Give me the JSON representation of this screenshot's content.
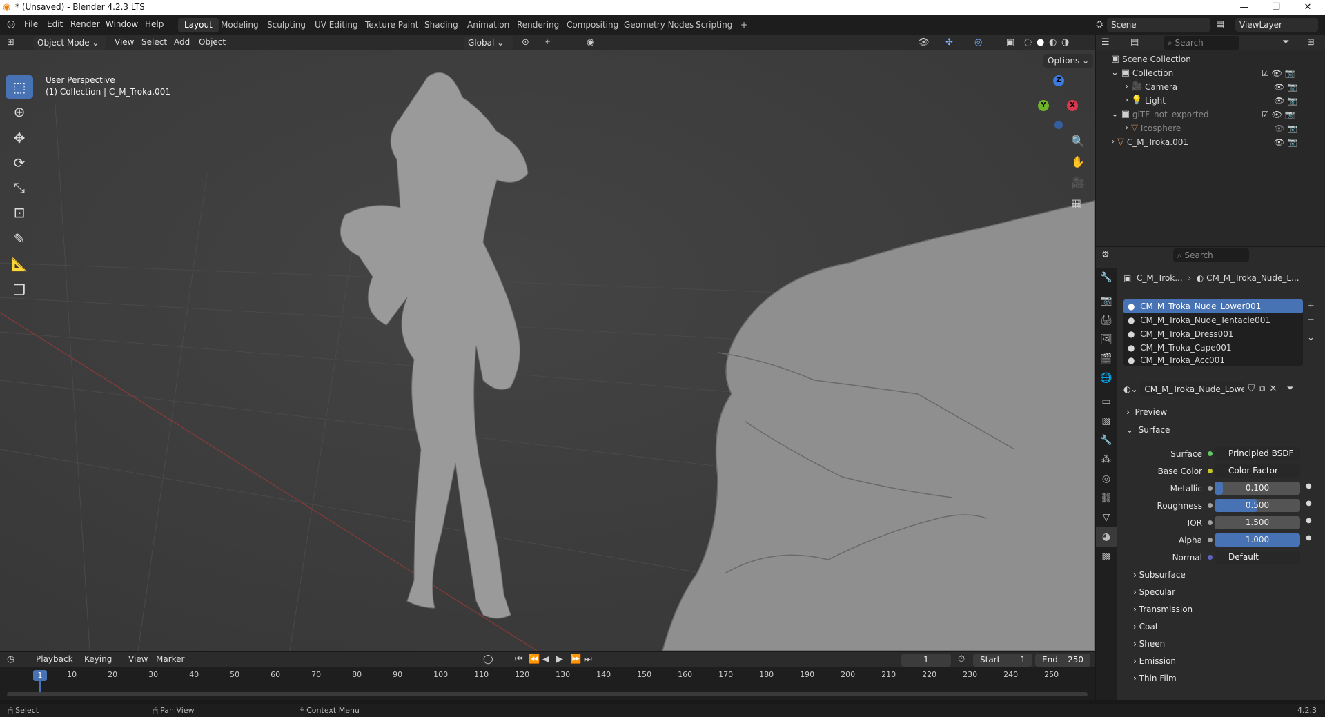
{
  "window": {
    "title": "* (Unsaved) - Blender 4.2.3 LTS",
    "min": "—",
    "max": "❐",
    "close": "✕"
  },
  "menu": [
    "File",
    "Edit",
    "Render",
    "Window",
    "Help"
  ],
  "workspaces": [
    "Layout",
    "Modeling",
    "Sculpting",
    "UV Editing",
    "Texture Paint",
    "Shading",
    "Animation",
    "Rendering",
    "Compositing",
    "Geometry Nodes",
    "Scripting"
  ],
  "add_ws": "+",
  "scene": {
    "name": "Scene",
    "viewlayer": "ViewLayer"
  },
  "viewport": {
    "mode": "Object Mode",
    "menus": [
      "View",
      "Select",
      "Add",
      "Object"
    ],
    "orientation": "Global",
    "options": "Options",
    "overlay_line1": "User Perspective",
    "overlay_line2": "(1) Collection | C_M_Troka.001",
    "gizmo": {
      "z": "Z",
      "y": "Y",
      "x": "X"
    }
  },
  "outliner": {
    "search_placeholder": "Search",
    "rows": [
      {
        "label": "Scene Collection"
      },
      {
        "label": "Collection"
      },
      {
        "label": "Camera"
      },
      {
        "label": "Light"
      },
      {
        "label": "glTF_not_exported"
      },
      {
        "label": "Icosphere"
      },
      {
        "label": "C_M_Troka.001"
      }
    ]
  },
  "properties": {
    "search_placeholder": "Search",
    "breadcrumb_obj": "C_M_Trok...",
    "breadcrumb_mat": "CM_M_Troka_Nude_L...",
    "slots": [
      "CM_M_Troka_Nude_Lower001",
      "CM_M_Troka_Nude_Tentacle001",
      "CM_M_Troka_Dress001",
      "CM_M_Troka_Cape001",
      "CM_M_Troka_Acc001"
    ],
    "material_name": "CM_M_Troka_Nude_Lowe...",
    "preview": "Preview",
    "surface": "Surface",
    "fields": [
      {
        "label": "Surface",
        "value": "Principled BSDF",
        "type": "socket",
        "dot": "#63c763"
      },
      {
        "label": "Base Color",
        "value": "Color Factor",
        "type": "socket",
        "dot": "#c7c729"
      },
      {
        "label": "Metallic",
        "value": "0.100",
        "type": "slider",
        "fill": 0.1
      },
      {
        "label": "Roughness",
        "value": "0.500",
        "type": "slider",
        "fill": 0.5
      },
      {
        "label": "IOR",
        "value": "1.500",
        "type": "slider",
        "fill": 0
      },
      {
        "label": "Alpha",
        "value": "1.000",
        "type": "slider",
        "fill": 1
      },
      {
        "label": "Normal",
        "value": "Default",
        "type": "socket",
        "dot": "#6363c7"
      }
    ],
    "subpanels": [
      "Subsurface",
      "Specular",
      "Transmission",
      "Coat",
      "Sheen",
      "Emission",
      "Thin Film"
    ]
  },
  "timeline": {
    "menus": [
      "Playback",
      "Keying",
      "View",
      "Marker"
    ],
    "current": "1",
    "start_label": "Start",
    "start": "1",
    "end_label": "End",
    "end": "250",
    "ticks": [
      "1",
      "10",
      "20",
      "30",
      "40",
      "50",
      "60",
      "70",
      "80",
      "90",
      "100",
      "110",
      "120",
      "130",
      "140",
      "150",
      "160",
      "170",
      "180",
      "190",
      "200",
      "210",
      "220",
      "230",
      "240",
      "250"
    ]
  },
  "status": {
    "select": "Select",
    "pan": "Pan View",
    "context": "Context Menu",
    "version": "4.2.3"
  }
}
